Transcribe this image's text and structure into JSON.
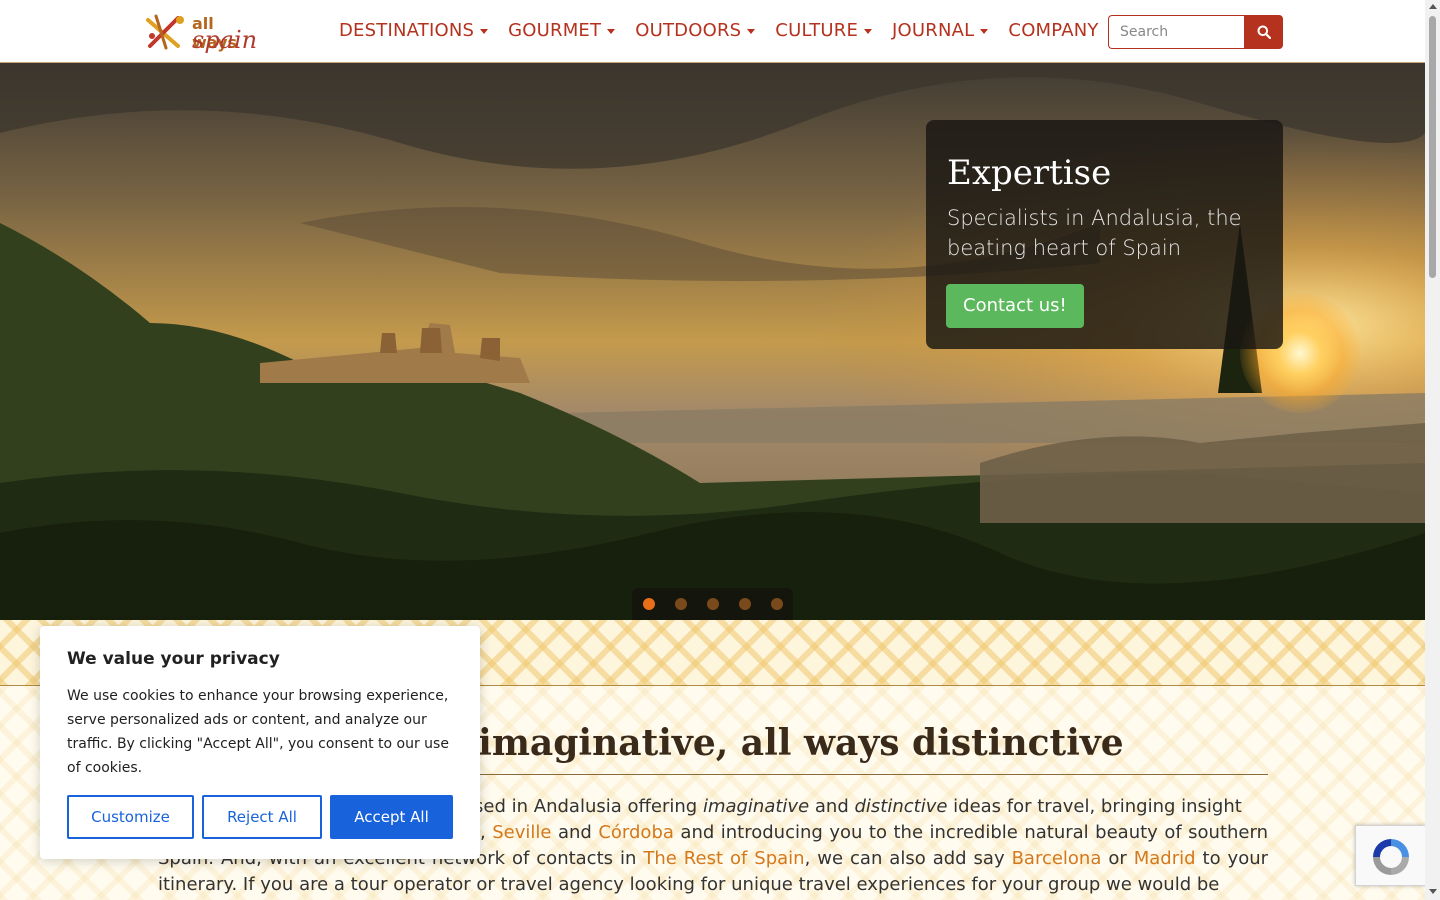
{
  "brand": {
    "line1": "all ways",
    "line2": "spain"
  },
  "nav": {
    "items": [
      {
        "label": "DESTINATIONS",
        "dropdown": true
      },
      {
        "label": "GOURMET",
        "dropdown": true
      },
      {
        "label": "OUTDOORS",
        "dropdown": true
      },
      {
        "label": "CULTURE",
        "dropdown": true
      },
      {
        "label": "JOURNAL",
        "dropdown": true
      },
      {
        "label": "COMPANY",
        "dropdown": false
      }
    ],
    "search_placeholder": "Search"
  },
  "hero": {
    "title": "Expertise",
    "subtitle": "Specialists in Andalusia, the beating heart of Spain",
    "cta": "Contact us!",
    "slide_count": 5,
    "active_slide": 1
  },
  "main": {
    "heading": "All ways imaginative, all ways distinctive",
    "para_a": "ased in Andalusia offering ",
    "em1": "imaginative",
    "para_b": " and ",
    "em2": "distinctive",
    "para_c": " ideas for travel, bringing insight",
    "para_d": ", ",
    "link_seville": "Seville",
    "para_e": " and ",
    "link_cordoba": "Córdoba",
    "para_f": " and introducing you to the incredible natural beauty of southern Spain. And, with an excellent network of contacts in ",
    "link_rest": "The Rest of Spain",
    "para_g": ", we can also add say ",
    "link_barcelona": "Barcelona",
    "para_h": " or ",
    "link_madrid": "Madrid",
    "para_i": " to your itinerary. If you are a tour operator or travel agency looking for unique travel experiences for your group we would be"
  },
  "cookie": {
    "title": "We value your privacy",
    "text": "We use cookies to enhance your browsing experience, serve personalized ads or content, and analyze our traffic. By clicking \"Accept All\", you consent to our use of cookies.",
    "customize": "Customize",
    "reject": "Reject All",
    "accept": "Accept All"
  },
  "colors": {
    "brand_red": "#b5321e",
    "cta_green": "#5cb85c",
    "link_orange": "#d4781c",
    "cookie_blue": "#1863dc"
  }
}
